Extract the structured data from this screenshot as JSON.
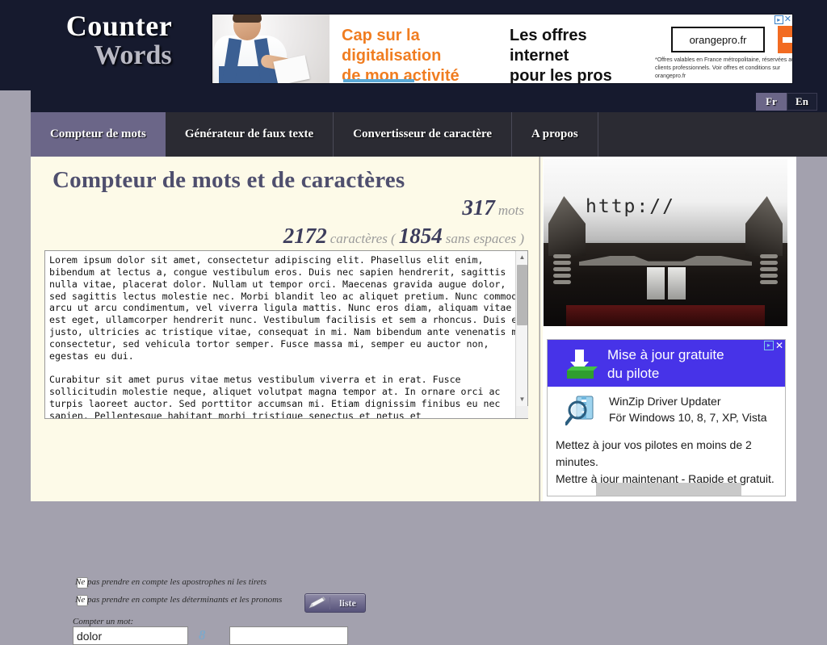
{
  "brand": {
    "line1": "Counter",
    "line2": "Words"
  },
  "top_ad": {
    "headline_orange": "Cap sur la\ndigitalisation\nde mon activité",
    "headline_black": "Les offres\ninternet\npour les pros",
    "logo": "orangepro.fr",
    "fine_print": "*Offres valables en France métropolitaine, réservées aux clients professionnels. Voir offres et conditions sur orangepro.fr",
    "adchoices_icon": "adchoices-triangle-icon",
    "close_icon": "close-icon"
  },
  "language": {
    "fr": "Fr",
    "en": "En",
    "selected": "Fr"
  },
  "nav": {
    "tabs": [
      {
        "label": "Compteur de mots",
        "active": true
      },
      {
        "label": "Générateur de faux texte",
        "active": false
      },
      {
        "label": "Convertisseur de caractère",
        "active": false
      },
      {
        "label": "A propos",
        "active": false
      }
    ]
  },
  "main": {
    "title": "Compteur de mots et de caractères",
    "word_count": "317",
    "word_label": "mots",
    "char_count": "2172",
    "char_label": "caractères (",
    "char_nospace_count": "1854",
    "char_nospace_label": "sans espaces )",
    "plugin_icon": "puzzle-piece-icon",
    "textarea_value": "Lorem ipsum dolor sit amet, consectetur adipiscing elit. Phasellus elit enim, bibendum at lectus a, congue vestibulum eros. Duis nec sapien hendrerit, sagittis nulla vitae, placerat dolor. Nullam ut tempor orci. Maecenas gravida augue dolor, sed sagittis lectus molestie nec. Morbi blandit leo ac aliquet pretium. Nunc commodo arcu ut arcu condimentum, vel viverra ligula mattis. Nunc eros diam, aliquam vitae est eget, ullamcorper hendrerit nunc. Vestibulum facilisis et sem a rhoncus. Duis ex justo, ultricies ac tristique vitae, consequat in mi. Nam bibendum ante venenatis mi consectetur, sed vehicula tortor semper. Fusce massa mi, semper eu auctor non, egestas eu dui.\n\nCurabitur sit amet purus vitae metus vestibulum viverra et in erat. Fusce sollicitudin molestie neque, aliquet volutpat magna tempor at. In ornare orci ac turpis laoreet auctor. Sed porttitor accumsan mi. Etiam dignissim finibus eu nec sapien. Pellentesque habitant morbi tristique senectus et netus et",
    "scrollbar": {
      "up_icon": "scroll-up-arrow-icon",
      "down_icon": "scroll-down-arrow-icon",
      "resize_icon": "resize-grip-icon"
    },
    "option_1": "Ne pas prendre en compte les apostrophes ni les tirets",
    "option_1_checked": false,
    "option_2": "Ne pas prendre en compte les déterminants et les pronoms",
    "option_2_checked": false,
    "liste_button": "liste",
    "liste_icon": "pencil-icon",
    "count_word_label": "Compter un mot:",
    "count_word_value": "dolor",
    "count_word_result": "8",
    "count_word_second_value": ""
  },
  "sidebar": {
    "typewriter_text": "http://",
    "ad": {
      "title": "Mise à jour gratuite\ndu pilote",
      "product": "WinZip Driver Updater",
      "platforms": "För Windows 10, 8, 7, XP, Vista",
      "body_line1": "Mettez à jour vos pilotes en moins de 2 minutes.",
      "body_line2": "Mettre à jour maintenant - Rapide et gratuit.",
      "download_icon": "download-arrow-icon",
      "app_icon": "winzip-magnifier-icon",
      "adchoices_icon": "adchoices-triangle-icon",
      "close_icon": "close-icon"
    }
  },
  "colors": {
    "header_dark": "#161a2e",
    "tab_active": "#6b6688",
    "content_bg": "#fdfae8",
    "gutter": "#a3a1ae",
    "title": "#4f4f6e",
    "accent_orange": "#f07d21",
    "ad_blue": "#4733e8",
    "count_blue": "#7fa8c9"
  }
}
